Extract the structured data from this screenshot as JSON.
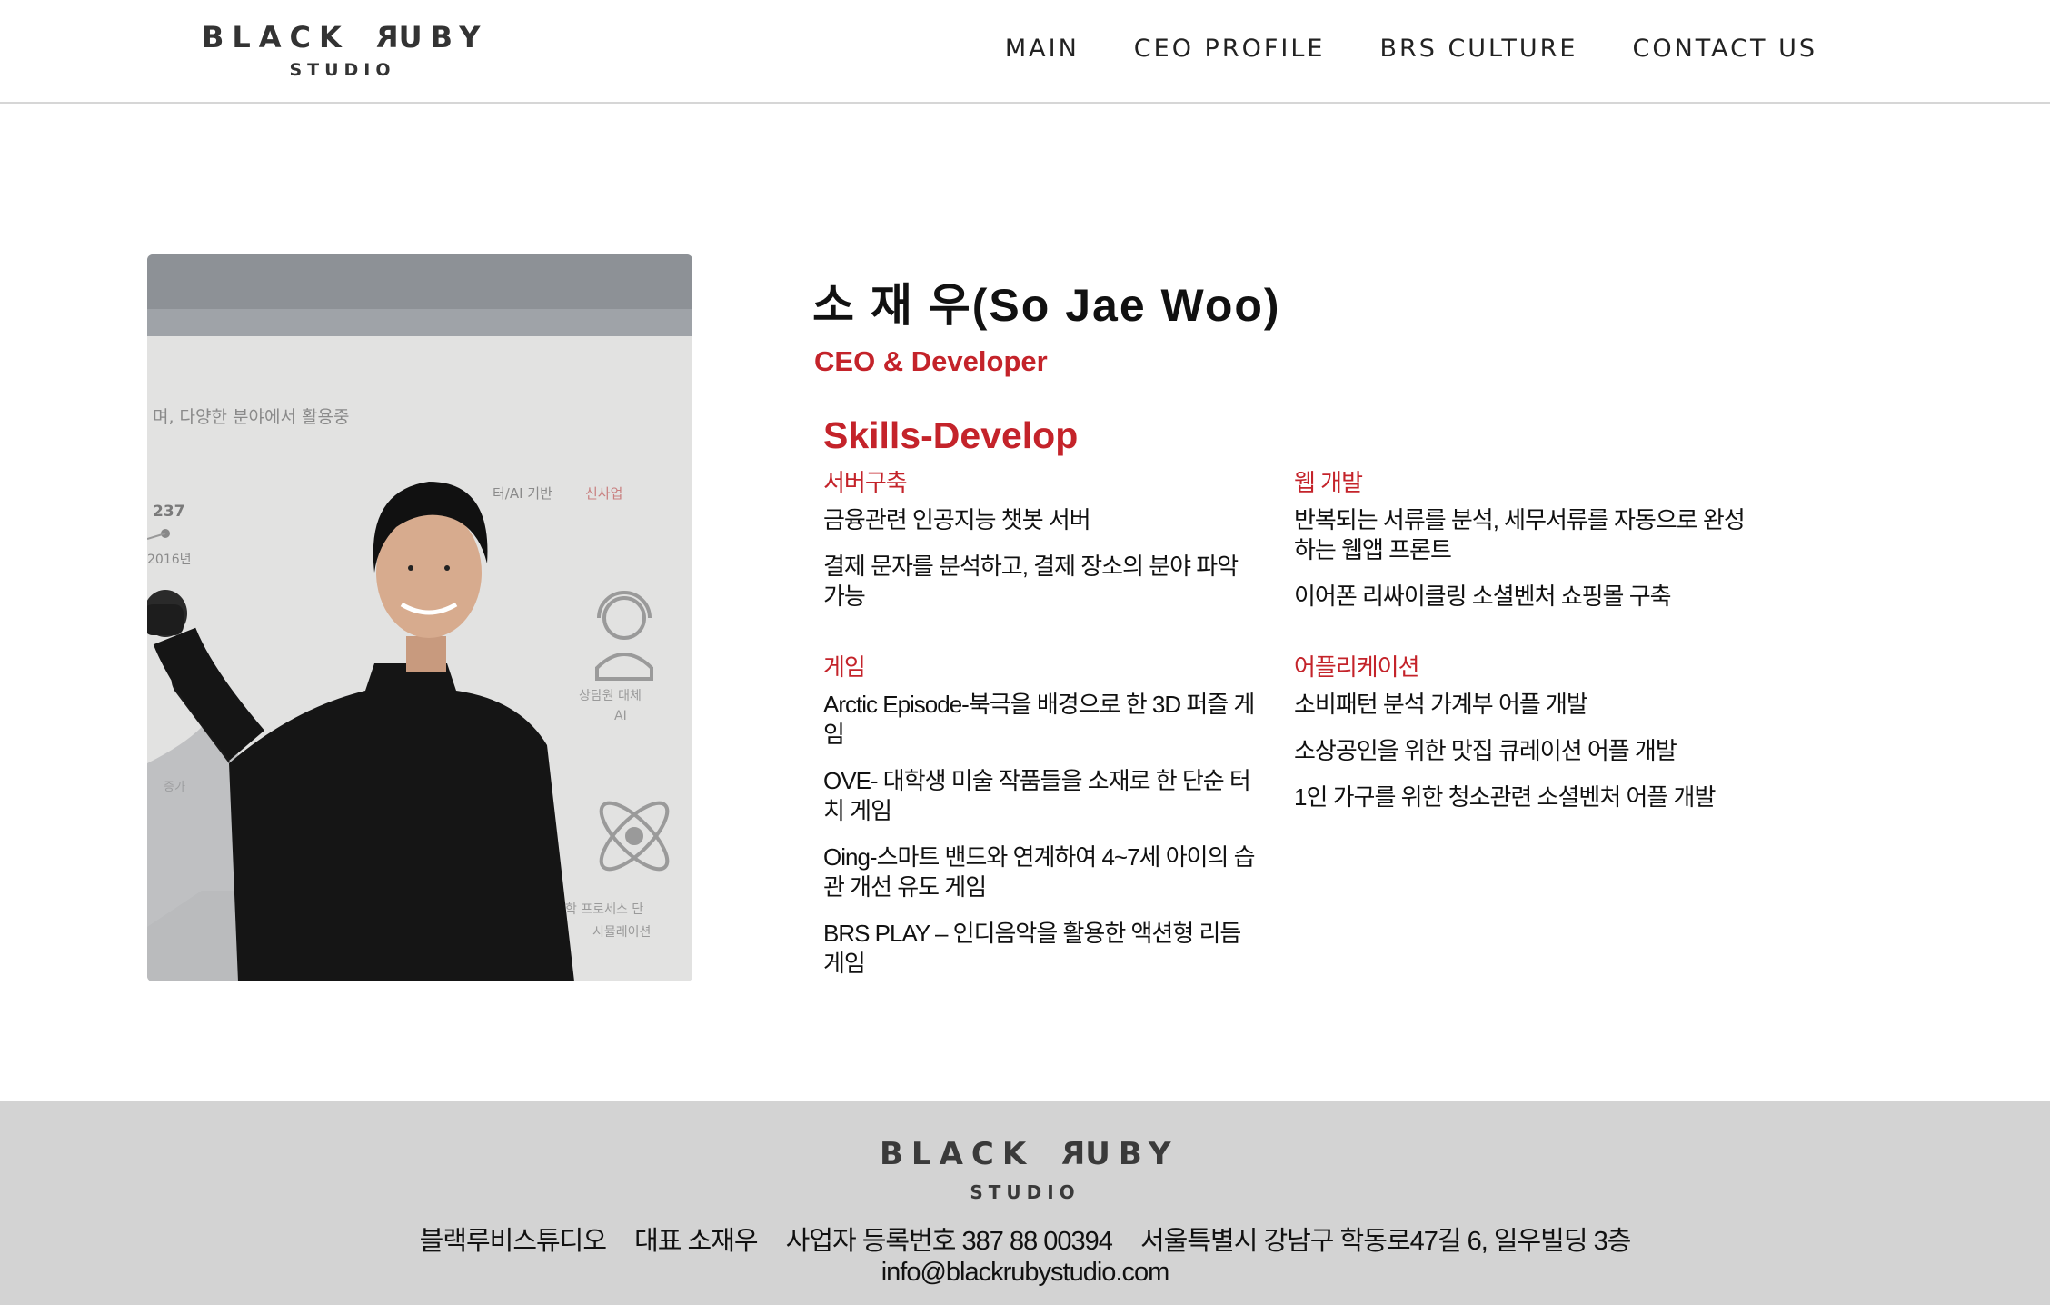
{
  "brand": {
    "logo_main_a": "BLACK ",
    "logo_main_r": "R",
    "logo_main_b": "UBY",
    "logo_sub": "STUDIO"
  },
  "nav": [
    {
      "label": "MAIN"
    },
    {
      "label": "CEO PROFILE"
    },
    {
      "label": "BRS CULTURE"
    },
    {
      "label": "CONTACT US"
    }
  ],
  "photo": {
    "slide_text_1": "며, 다양한 분야에서 활용중",
    "slide_text_2": "터/AI 기반",
    "slide_text_3": "신사업",
    "slide_num": "237",
    "slide_year": "2016년",
    "slide_label_1": "상담원 대체",
    "slide_label_2": "AI",
    "slide_label_3": "증가",
    "slide_label_4": "학 프로세스 단",
    "slide_label_5": "시뮬레이션"
  },
  "profile": {
    "name": "소 재 우(So Jae Woo)",
    "role": "CEO & Developer",
    "skills_title": "Skills-Develop"
  },
  "skills": {
    "server": {
      "title": "서버구축",
      "items": [
        "금융관련 인공지능 챗봇 서버",
        "결제 문자를 분석하고, 결제 장소의 분야 파악 가능"
      ]
    },
    "game": {
      "title": "게임",
      "items": [
        "Arctic Episode-북극을 배경으로 한 3D 퍼즐 게임",
        "OVE- 대학생 미술 작품들을 소재로 한 단순 터치 게임",
        "Oing-스마트 밴드와 연계하여 4~7세 아이의 습관 개선 유도 게임",
        "BRS PLAY – 인디음악을 활용한 액션형 리듬게임"
      ]
    },
    "web": {
      "title": "웹 개발",
      "items": [
        "반복되는 서류를 분석, 세무서류를 자동으로 완성하는 웹앱 프론트",
        "이어폰 리싸이클링 소셜벤처 쇼핑몰 구축"
      ]
    },
    "app": {
      "title": "어플리케이션",
      "items": [
        "소비패턴 분석 가계부 어플 개발",
        "소상공인을 위한 맛집 큐레이션 어플 개발",
        "1인 가구를 위한 청소관련 소셜벤처 어플 개발"
      ]
    }
  },
  "footer": {
    "company": "블랙루비스튜디오",
    "ceo": "대표 소재우",
    "biz_number": "사업자 등록번호 387 88 00394",
    "address": "서울특별시 강남구 학동로47길 6, 일우빌딩 3층",
    "email": "info@blackrubystudio.com"
  }
}
